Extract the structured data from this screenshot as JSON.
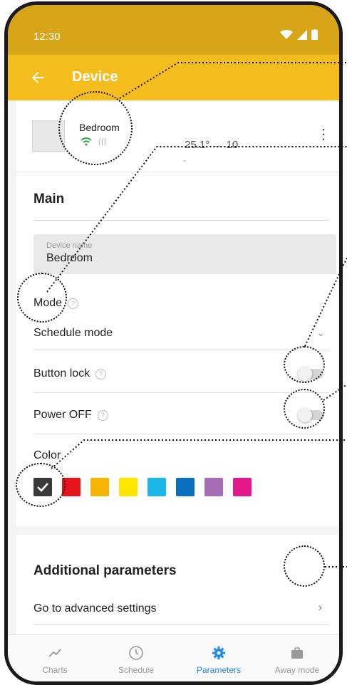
{
  "status": {
    "time": "12:30"
  },
  "appbar": {
    "title": "Device"
  },
  "device": {
    "name": "Bedroom",
    "temp_current": "25.1°",
    "temp_arrow": "→",
    "temp_target": "10"
  },
  "main": {
    "title": "Main",
    "device_name_field": {
      "label": "Device name",
      "value": "Bedroom"
    },
    "mode": {
      "label": "Mode",
      "value": "Schedule mode"
    },
    "button_lock": {
      "label": "Button lock",
      "on": false
    },
    "power_off": {
      "label": "Power OFF",
      "on": false
    },
    "color": {
      "label": "Color",
      "swatches": [
        "#3a3a3a",
        "#e8141c",
        "#f6b400",
        "#ffe600",
        "#1ab8e8",
        "#0a6fbf",
        "#a56ab3",
        "#e5178c"
      ],
      "selected_index": 0
    }
  },
  "additional": {
    "title": "Additional parameters",
    "link": "Go to advanced settings"
  },
  "nav": {
    "items": [
      "Charts",
      "Schedule",
      "Parameters",
      "Away mode"
    ],
    "active_index": 2
  },
  "colors": {
    "status_bar": "#d8a418",
    "app_bar": "#f6bd1e",
    "accent": "#1e88e5"
  }
}
